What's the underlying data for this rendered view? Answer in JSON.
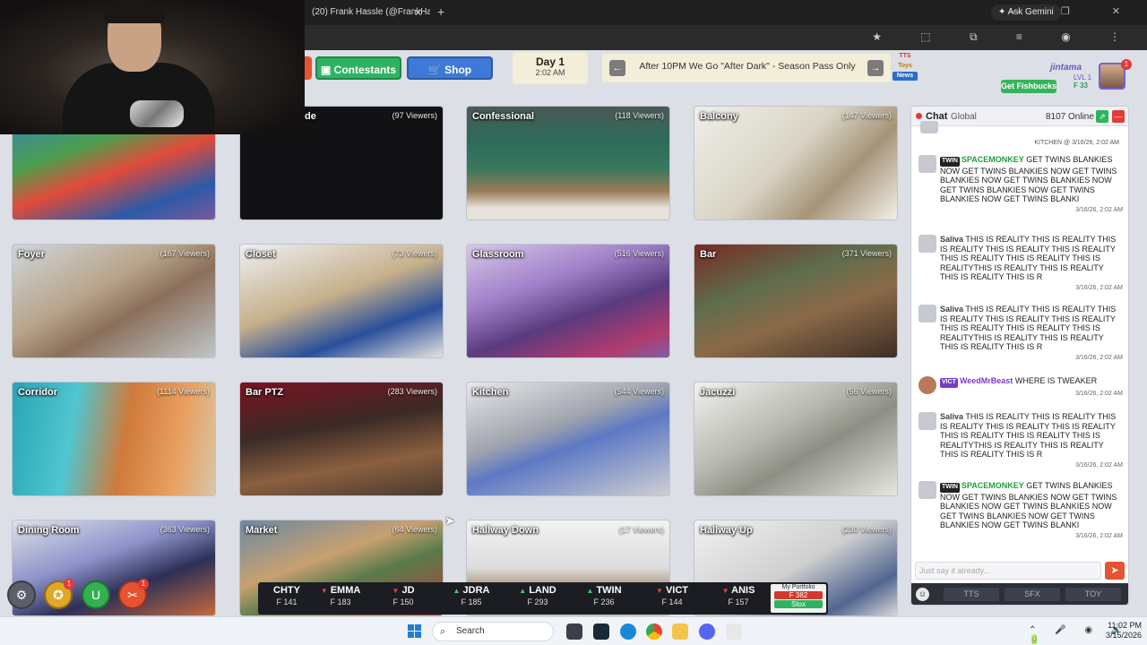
{
  "browser": {
    "tab_title": "(20) Frank Hassle (@FrankHassle)",
    "tab_close": "✕",
    "new_tab": "+",
    "ask_gemini": "✦ Ask Gemini",
    "window_controls": "— ❐ ✕",
    "address_icons": "★ ⬚ ⧉ ≡ ◉ ⋮"
  },
  "header": {
    "contestants_label": "Contestants",
    "shop_label": "Shop",
    "day_label": "Day 1",
    "day_time": "2:02 AM",
    "ticker_text": "After 10PM We Go \"After Dark\" - Season Pass Only",
    "tags": [
      "TTS",
      "Toys",
      "News"
    ]
  },
  "account": {
    "username": "jintama",
    "level": "LVL 1",
    "credits": "F 33",
    "fishbucks_label": "Get Fishbucks",
    "notifications": "1"
  },
  "cameras": [
    {
      "name": "de",
      "viewers": "(97 Viewers)"
    },
    {
      "name": "Confessional",
      "viewers": "(118 Viewers)"
    },
    {
      "name": "Balcony",
      "viewers": "(147 Viewers)"
    },
    {
      "name": "",
      "viewers": ""
    },
    {
      "name": "Foyer",
      "viewers": "(167 Viewers)"
    },
    {
      "name": "Closet",
      "viewers": "(73 Viewers)"
    },
    {
      "name": "Glassroom",
      "viewers": "(516 Viewers)"
    },
    {
      "name": "Bar",
      "viewers": "(371 Viewers)"
    },
    {
      "name": "Corridor",
      "viewers": "(1114 Viewers)"
    },
    {
      "name": "Bar PTZ",
      "viewers": "(283 Viewers)"
    },
    {
      "name": "Kitchen",
      "viewers": "(544 Viewers)"
    },
    {
      "name": "Jacuzzi",
      "viewers": "(56 Viewers)"
    },
    {
      "name": "Dining Room",
      "viewers": "(363 Viewers)"
    },
    {
      "name": "Market",
      "viewers": "(64 Viewers)"
    },
    {
      "name": "Hallway Down",
      "viewers": "(17 Viewers)"
    },
    {
      "name": "Hallway Up",
      "viewers": "(230 Viewers)"
    }
  ],
  "controls": {
    "gear_icon": "⚙",
    "coins_icon": "✪",
    "magnet_icon": "U",
    "tools_icon": "✂",
    "coins_badge": "1",
    "tools_badge": "1"
  },
  "stocks": [
    {
      "symbol": "CHTY",
      "price": "F 141",
      "trend": "",
      "arrow": ""
    },
    {
      "symbol": "EMMA",
      "price": "F 183",
      "trend": "down",
      "arrow": "▼"
    },
    {
      "symbol": "JD",
      "price": "F 150",
      "trend": "down",
      "arrow": "▼"
    },
    {
      "symbol": "JDRA",
      "price": "F 185",
      "trend": "up",
      "arrow": "▲"
    },
    {
      "symbol": "LAND",
      "price": "F 293",
      "trend": "up",
      "arrow": "▲"
    },
    {
      "symbol": "TWIN",
      "price": "F 236",
      "trend": "up",
      "arrow": "▲"
    },
    {
      "symbol": "VICT",
      "price": "F 144",
      "trend": "down",
      "arrow": "▼"
    },
    {
      "symbol": "ANIS",
      "price": "F 157",
      "trend": "down",
      "arrow": "▼"
    }
  ],
  "portfolio": {
    "label": "My Portfolio",
    "value": "F 382",
    "button": "Stox"
  },
  "chat": {
    "title": "Chat",
    "room": "Global",
    "online": "8107 Online",
    "top_meta": "KITCHEN @ 3/16/26, 2:02 AM",
    "messages": [
      {
        "badge": "TWIN",
        "user": "SPACEMONKEY",
        "text": "GET TWINS BLANKIES NOW GET TWINS BLANKIES NOW GET TWINS BLANKIES NOW GET TWINS BLANKIES NOW GET TWINS BLANKIES NOW GET TWINS BLANKIES NOW GET TWINS BLANKI",
        "time": "3/16/26, 2:02 AM"
      },
      {
        "badge": "",
        "user": "Saliva",
        "text": "THIS IS REALITY THIS IS REALITY THIS IS REALITY THIS IS REALITY THIS IS REALITY THIS IS REALITY THIS IS REALITY THIS IS REALITYTHIS IS REALITY THIS IS REALITY THIS IS REALITY THIS IS R",
        "time": "3/16/26, 2:02 AM"
      },
      {
        "badge": "",
        "user": "Saliva",
        "text": "THIS IS REALITY THIS IS REALITY THIS IS REALITY THIS IS REALITY THIS IS REALITY THIS IS REALITY THIS IS REALITY THIS IS REALITYTHIS IS REALITY THIS IS REALITY THIS IS REALITY THIS IS R",
        "time": "3/16/26, 2:02 AM"
      },
      {
        "badge": "VICT",
        "user": "WeedMrBeast",
        "text": "WHERE IS TWEAKER",
        "time": "3/16/26, 2:02 AM"
      },
      {
        "badge": "",
        "user": "Saliva",
        "text": "THIS IS REALITY THIS IS REALITY THIS IS REALITY THIS IS REALITY THIS IS REALITY THIS IS REALITY THIS IS REALITY THIS IS REALITYTHIS IS REALITY THIS IS REALITY THIS IS REALITY THIS IS R",
        "time": "3/16/26, 2:02 AM"
      },
      {
        "badge": "TWIN",
        "user": "SPACEMONKEY",
        "text": "GET TWINS BLANKIES NOW GET TWINS BLANKIES NOW GET TWINS BLANKIES NOW GET TWINS BLANKIES NOW GET TWINS BLANKIES NOW GET TWINS BLANKIES NOW GET TWINS BLANKI",
        "time": "3/16/26, 2:02 AM"
      }
    ],
    "input_placeholder": "Just say it already...",
    "tools": [
      "TTS",
      "SFX",
      "TOY"
    ]
  },
  "taskbar": {
    "search_label": "Search",
    "time": "11:02 PM",
    "date": "3/15/2026",
    "tray": "⌃ 🎤 ◉ 🔊 🔋"
  }
}
